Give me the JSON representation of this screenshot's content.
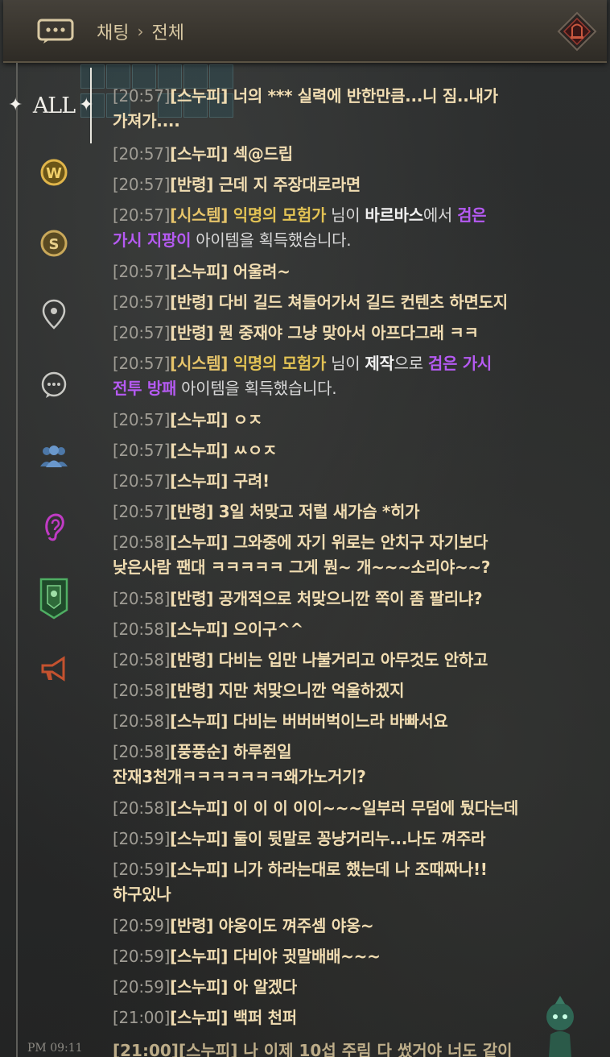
{
  "header": {
    "breadcrumb_root": "채팅",
    "breadcrumb_sep": "›",
    "breadcrumb_current": "전체"
  },
  "sidebar": {
    "items": [
      {
        "label": "ALL",
        "icon": "all-tab",
        "active": true
      },
      {
        "label": "",
        "icon": "world-chat-icon"
      },
      {
        "label": "",
        "icon": "server-chat-icon"
      },
      {
        "label": "",
        "icon": "location-chat-icon"
      },
      {
        "label": "",
        "icon": "general-chat-icon"
      },
      {
        "label": "",
        "icon": "party-chat-icon"
      },
      {
        "label": "",
        "icon": "whisper-ear-icon"
      },
      {
        "label": "",
        "icon": "guild-banner-icon"
      },
      {
        "label": "",
        "icon": "megaphone-icon"
      }
    ]
  },
  "messages": [
    {
      "lines": [
        [
          [
            "time",
            "[20:57]"
          ],
          [
            "name",
            "[스누피]"
          ],
          [
            "text",
            " 너의 *** 실력에 반한만큼...니 짐..내가"
          ]
        ],
        [
          [
            "text",
            "가져가...."
          ]
        ]
      ]
    },
    {
      "lines": [
        [
          [
            "time",
            "[20:57]"
          ],
          [
            "name",
            "[스누피]"
          ],
          [
            "text",
            " 섹@드립"
          ]
        ]
      ]
    },
    {
      "lines": [
        [
          [
            "time",
            "[20:57]"
          ],
          [
            "name",
            "[반령]"
          ],
          [
            "text",
            " 근데 지 주장대로라면"
          ]
        ]
      ]
    },
    {
      "lines": [
        [
          [
            "time",
            "[20:57]"
          ],
          [
            "sys",
            "[시스템]"
          ],
          [
            "yellow",
            " 익명의 모험가"
          ],
          [
            "grey",
            " 님이 "
          ],
          [
            "white",
            "바르바스"
          ],
          [
            "grey",
            "에서 "
          ],
          [
            "purple",
            "검은"
          ]
        ],
        [
          [
            "purple",
            "가시 지팡이"
          ],
          [
            "grey",
            " 아이템을 획득했습니다."
          ]
        ]
      ]
    },
    {
      "lines": [
        [
          [
            "time",
            "[20:57]"
          ],
          [
            "name",
            "[스누피]"
          ],
          [
            "text",
            " 어울려~"
          ]
        ]
      ]
    },
    {
      "lines": [
        [
          [
            "time",
            "[20:57]"
          ],
          [
            "name",
            "[반령]"
          ],
          [
            "text",
            " 다비 길드 쳐들어가서 길드 컨텐츠 하면도지"
          ]
        ]
      ]
    },
    {
      "lines": [
        [
          [
            "time",
            "[20:57]"
          ],
          [
            "name",
            "[반령]"
          ],
          [
            "text",
            " 뭔 중재야 그냥 맞아서 아프다그래 ㅋㅋ"
          ]
        ]
      ]
    },
    {
      "lines": [
        [
          [
            "time",
            "[20:57]"
          ],
          [
            "sys",
            "[시스템]"
          ],
          [
            "yellow",
            " 익명의 모험가"
          ],
          [
            "grey",
            " 님이 "
          ],
          [
            "white",
            "제작"
          ],
          [
            "grey",
            "으로 "
          ],
          [
            "purple",
            "검은 가시"
          ]
        ],
        [
          [
            "purple",
            "전투 방패"
          ],
          [
            "grey",
            " 아이템을 획득했습니다."
          ]
        ]
      ]
    },
    {
      "lines": [
        [
          [
            "time",
            "[20:57]"
          ],
          [
            "name",
            "[스누피]"
          ],
          [
            "text",
            " ㅇㅈ"
          ]
        ]
      ]
    },
    {
      "lines": [
        [
          [
            "time",
            "[20:57]"
          ],
          [
            "name",
            "[스누피]"
          ],
          [
            "text",
            " ㅆㅇㅈ"
          ]
        ]
      ]
    },
    {
      "lines": [
        [
          [
            "time",
            "[20:57]"
          ],
          [
            "name",
            "[스누피]"
          ],
          [
            "text",
            " 구려!"
          ]
        ]
      ]
    },
    {
      "lines": [
        [
          [
            "time",
            "[20:57]"
          ],
          [
            "name",
            "[반령]"
          ],
          [
            "text",
            " 3일 처맞고 저럴 새가슴 *히가"
          ]
        ]
      ]
    },
    {
      "lines": [
        [
          [
            "time",
            "[20:58]"
          ],
          [
            "name",
            "[스누피]"
          ],
          [
            "text",
            " 그와중에 자기 위로는 안치구 자기보다"
          ]
        ],
        [
          [
            "text",
            "낮은사람 팬대 ㅋㅋㅋㅋㅋ 그게 뭔~ 개~~~소리야~~?"
          ]
        ]
      ]
    },
    {
      "lines": [
        [
          [
            "time",
            "[20:58]"
          ],
          [
            "name",
            "[반령]"
          ],
          [
            "text",
            " 공개적으로 처맞으니깐 쪽이 좀 팔리냐?"
          ]
        ]
      ]
    },
    {
      "lines": [
        [
          [
            "time",
            "[20:58]"
          ],
          [
            "name",
            "[스누피]"
          ],
          [
            "text",
            " 으이구^^"
          ]
        ]
      ]
    },
    {
      "lines": [
        [
          [
            "time",
            "[20:58]"
          ],
          [
            "name",
            "[반령]"
          ],
          [
            "text",
            " 다비는 입만 나불거리고 아무것도 안하고"
          ]
        ]
      ]
    },
    {
      "lines": [
        [
          [
            "time",
            "[20:58]"
          ],
          [
            "name",
            "[반령]"
          ],
          [
            "text",
            " 지만 처맞으니깐 억울하겠지"
          ]
        ]
      ]
    },
    {
      "lines": [
        [
          [
            "time",
            "[20:58]"
          ],
          [
            "name",
            "[스누피]"
          ],
          [
            "text",
            " 다비는 버버버벅이느라 바빠서요"
          ]
        ]
      ]
    },
    {
      "lines": [
        [
          [
            "time",
            "[20:58]"
          ],
          [
            "name",
            "[풍풍순]"
          ],
          [
            "text",
            " 하루쥔일"
          ]
        ],
        [
          [
            "text",
            "잔재3천개ㅋㅋㅋㅋㅋㅋㅋ왜가노거기?"
          ]
        ]
      ]
    },
    {
      "lines": [
        [
          [
            "time",
            "[20:58]"
          ],
          [
            "name",
            "[스누피]"
          ],
          [
            "text",
            " 이 이 이 이이~~~일부러 무덤에 뒀다는데"
          ]
        ]
      ]
    },
    {
      "lines": [
        [
          [
            "time",
            "[20:59]"
          ],
          [
            "name",
            "[스누피]"
          ],
          [
            "text",
            " 둘이 뒷말로 꽁냥거리누...나도 껴주라"
          ]
        ]
      ]
    },
    {
      "lines": [
        [
          [
            "time",
            "[20:59]"
          ],
          [
            "name",
            "[스누피]"
          ],
          [
            "text",
            " 니가 하라는대로 했는데 나 조때짜나!!"
          ]
        ],
        [
          [
            "text",
            "하구있나"
          ]
        ]
      ]
    },
    {
      "lines": [
        [
          [
            "time",
            "[20:59]"
          ],
          [
            "name",
            "[반령]"
          ],
          [
            "text",
            " 야옹이도 껴주셈 야옹~"
          ]
        ]
      ]
    },
    {
      "lines": [
        [
          [
            "time",
            "[20:59]"
          ],
          [
            "name",
            "[스누피]"
          ],
          [
            "text",
            " 다비야 귓말배배~~~"
          ]
        ]
      ]
    },
    {
      "lines": [
        [
          [
            "time",
            "[20:59]"
          ],
          [
            "name",
            "[스누피]"
          ],
          [
            "text",
            " 아 알겠다"
          ]
        ]
      ]
    },
    {
      "lines": [
        [
          [
            "time",
            "[21:00]"
          ],
          [
            "name",
            "[스누피]"
          ],
          [
            "text",
            " 백퍼 천퍼"
          ]
        ]
      ]
    }
  ],
  "cut_message": "[21:00][스누피] 나 이제 10섭 주림 다 썼거야 너도 같이",
  "clock": "PM 09:11",
  "colors": {
    "text": "#f1ddb2",
    "time": "#9f9c94",
    "adventurer": "#e3c354",
    "item": "#b55af2",
    "highlight": "#f2f2f2"
  }
}
